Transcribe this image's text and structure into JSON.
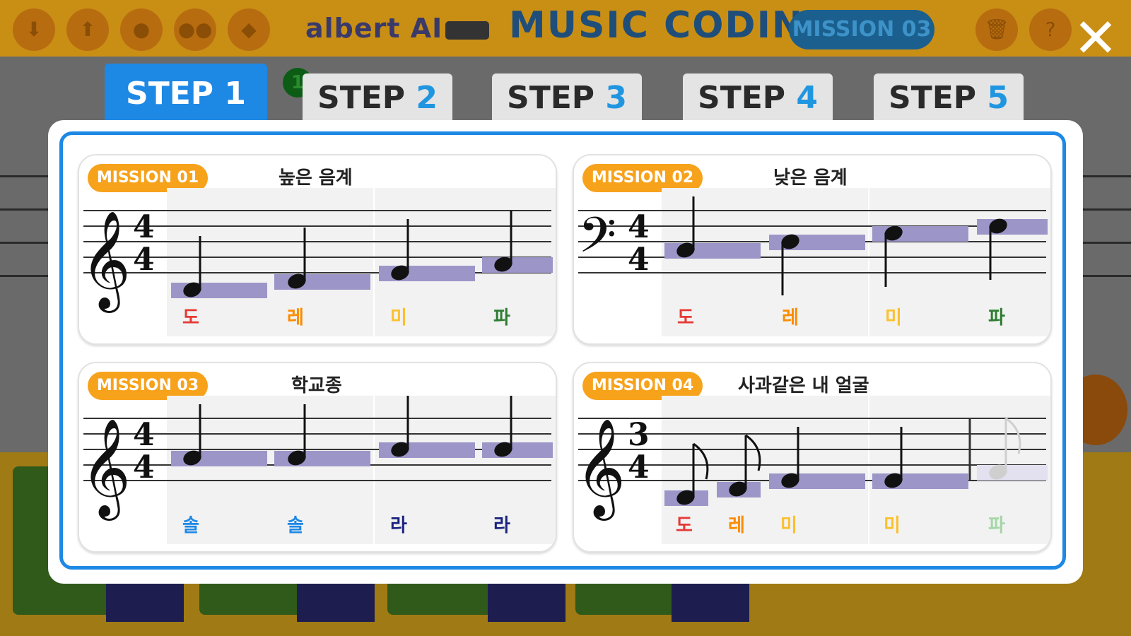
{
  "app": {
    "brand": "albert AI",
    "title": "MUSIC CODING",
    "mission_pill": "MISSION 03"
  },
  "toolbar": {
    "icons": [
      "download-icon",
      "upload-icon",
      "robot-icon",
      "eyes-icon",
      "bird-icon",
      "trash-icon",
      "help-icon",
      "close-icon"
    ]
  },
  "tabs": [
    {
      "word": "STEP ",
      "num": "1"
    },
    {
      "word": "STEP ",
      "num": "2"
    },
    {
      "word": "STEP ",
      "num": "3"
    },
    {
      "word": "STEP ",
      "num": "4"
    },
    {
      "word": "STEP ",
      "num": "5"
    }
  ],
  "active_tab": 0,
  "missions": [
    {
      "badge": "MISSION 01",
      "title": "높은 음계",
      "clef": "treble",
      "time_sig": [
        "4",
        "4"
      ],
      "notes": [
        {
          "label": "도",
          "color": "#e53935"
        },
        {
          "label": "레",
          "color": "#fb8c00"
        },
        {
          "label": "미",
          "color": "#fbc02d"
        },
        {
          "label": "파",
          "color": "#2e7d32"
        }
      ]
    },
    {
      "badge": "MISSION 02",
      "title": "낮은 음계",
      "clef": "bass",
      "time_sig": [
        "4",
        "4"
      ],
      "notes": [
        {
          "label": "도",
          "color": "#e53935"
        },
        {
          "label": "레",
          "color": "#fb8c00"
        },
        {
          "label": "미",
          "color": "#fbc02d"
        },
        {
          "label": "파",
          "color": "#2e7d32"
        }
      ]
    },
    {
      "badge": "MISSION 03",
      "title": "학교종",
      "clef": "treble",
      "time_sig": [
        "4",
        "4"
      ],
      "notes": [
        {
          "label": "솔",
          "color": "#1e88e5"
        },
        {
          "label": "솔",
          "color": "#1e88e5"
        },
        {
          "label": "라",
          "color": "#1a237e"
        },
        {
          "label": "라",
          "color": "#1a237e"
        }
      ]
    },
    {
      "badge": "MISSION 04",
      "title": "사과같은 내 얼굴",
      "clef": "treble",
      "time_sig": [
        "3",
        "4"
      ],
      "notes": [
        {
          "label": "도",
          "color": "#e53935"
        },
        {
          "label": "레",
          "color": "#fb8c00"
        },
        {
          "label": "미",
          "color": "#fbc02d"
        },
        {
          "label": "미",
          "color": "#fbc02d"
        },
        {
          "label": "파",
          "color": "#a5d6a7"
        }
      ]
    }
  ],
  "colors": {
    "accent": "#1e88e5",
    "badge": "#f7a21b",
    "note_bar": "#9c96c8"
  }
}
